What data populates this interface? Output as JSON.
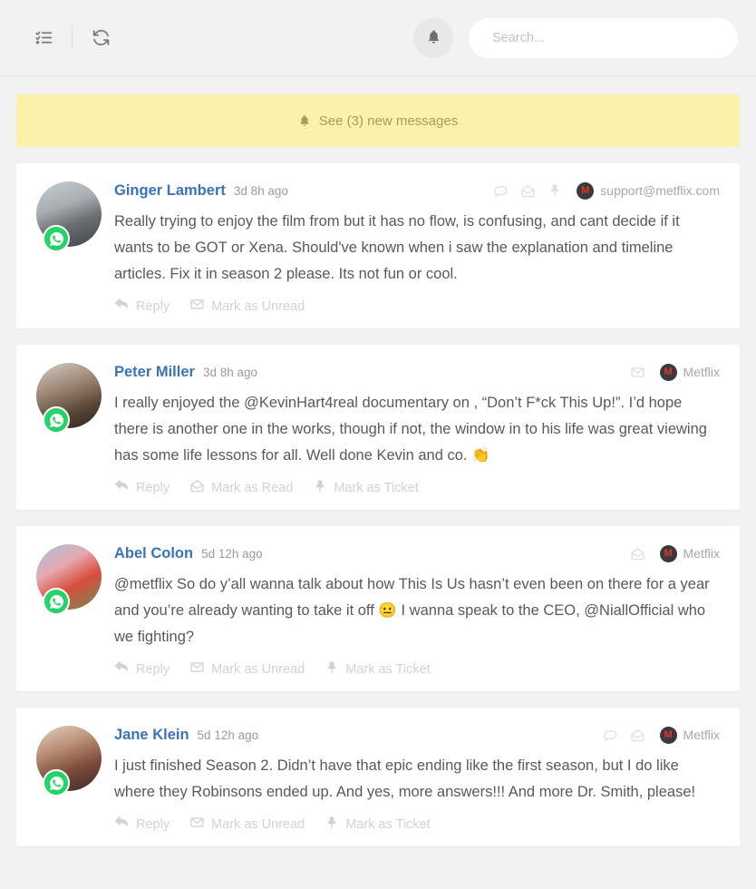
{
  "topbar": {
    "tasks_icon": "checklist-icon",
    "refresh_icon": "refresh-icon",
    "bell_icon": "bell-icon",
    "search": {
      "value": "",
      "placeholder": "Search..."
    }
  },
  "banner": {
    "icon": "bell-icon",
    "label": "See (3) new messages",
    "count": 3,
    "bg": "#fbf1a8",
    "text_color": "#b09a5a"
  },
  "brand": {
    "mark": "M",
    "accent": "#e3342f",
    "bubble": "#3a3a3a"
  },
  "messages": [
    {
      "author": "Ginger Lambert",
      "time": "3d 8h ago",
      "channel_badge": "whatsapp-icon",
      "head_icons": [
        "comment-icon",
        "envelope-open-icon",
        "pin-icon"
      ],
      "account": "support@metflix.com",
      "text": "Really trying to enjoy the film from but it has no flow, is confusing, and cant decide if it wants to be GOT or Xena. Should've known when i saw the explanation and timeline articles. Fix it in season 2 please. Its not fun or cool.",
      "actions": [
        {
          "label": "Reply",
          "icon": "reply-icon"
        },
        {
          "label": "Mark as Unread",
          "icon": "envelope-closed-icon"
        }
      ]
    },
    {
      "author": "Peter Miller",
      "time": "3d 8h ago",
      "channel_badge": "whatsapp-icon",
      "head_icons": [
        "envelope-closed-icon"
      ],
      "account": "Metflix",
      "text": "I really enjoyed the @KevinHart4real documentary on , “Don’t F*ck This Up!”. I’d hope there is another one in the works, though if not, the window in to his life was great viewing has some life lessons for all. Well done Kevin and co. 👏",
      "actions": [
        {
          "label": "Reply",
          "icon": "reply-icon"
        },
        {
          "label": "Mark as Read",
          "icon": "envelope-open-icon"
        },
        {
          "label": "Mark as Ticket",
          "icon": "pin-icon"
        }
      ]
    },
    {
      "author": "Abel Colon",
      "time": "5d 12h ago",
      "channel_badge": "whatsapp-icon",
      "head_icons": [
        "envelope-open-icon"
      ],
      "account": "Metflix",
      "text": "@metflix So do y’all wanna talk about how This Is Us hasn’t even been on there for a year and you’re already wanting to take it off 😐 I wanna speak to the CEO, @NiallOfficial who we fighting?",
      "actions": [
        {
          "label": "Reply",
          "icon": "reply-icon"
        },
        {
          "label": "Mark as Unread",
          "icon": "envelope-closed-icon"
        },
        {
          "label": "Mark as Ticket",
          "icon": "pin-icon"
        }
      ]
    },
    {
      "author": "Jane Klein",
      "time": "5d 12h ago",
      "channel_badge": "whatsapp-icon",
      "head_icons": [
        "comment-icon",
        "envelope-open-icon"
      ],
      "account": "Metflix",
      "text": "I just finished Season 2. Didn’t have that epic ending like the first season, but I do like where they Robinsons ended up. And yes, more answers!!! And more Dr. Smith, please!",
      "actions": [
        {
          "label": "Reply",
          "icon": "reply-icon"
        },
        {
          "label": "Mark as Unread",
          "icon": "envelope-closed-icon"
        },
        {
          "label": "Mark as Ticket",
          "icon": "pin-icon"
        }
      ]
    }
  ]
}
